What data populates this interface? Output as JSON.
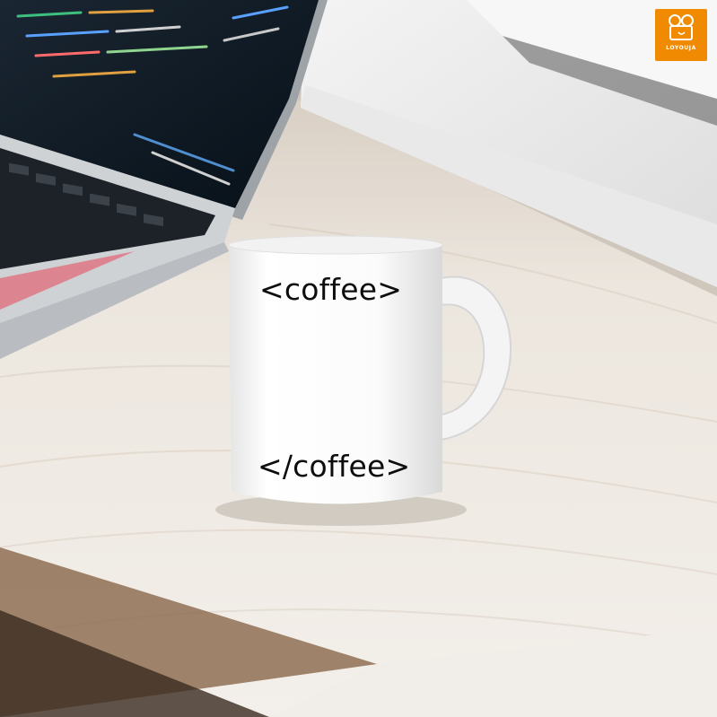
{
  "mug": {
    "text_top": "<coffee>",
    "text_bottom": "</coffee>"
  },
  "logo": {
    "text": "LOYOUJA",
    "color": "#f08a00",
    "icon": "camera-icon"
  },
  "colors": {
    "desk": "#efe9e2",
    "desk_edge": "#9a7a5d",
    "laptop_body": "#d5d6d8",
    "laptop_screen": "#0e1822",
    "mug": "#ffffff"
  }
}
